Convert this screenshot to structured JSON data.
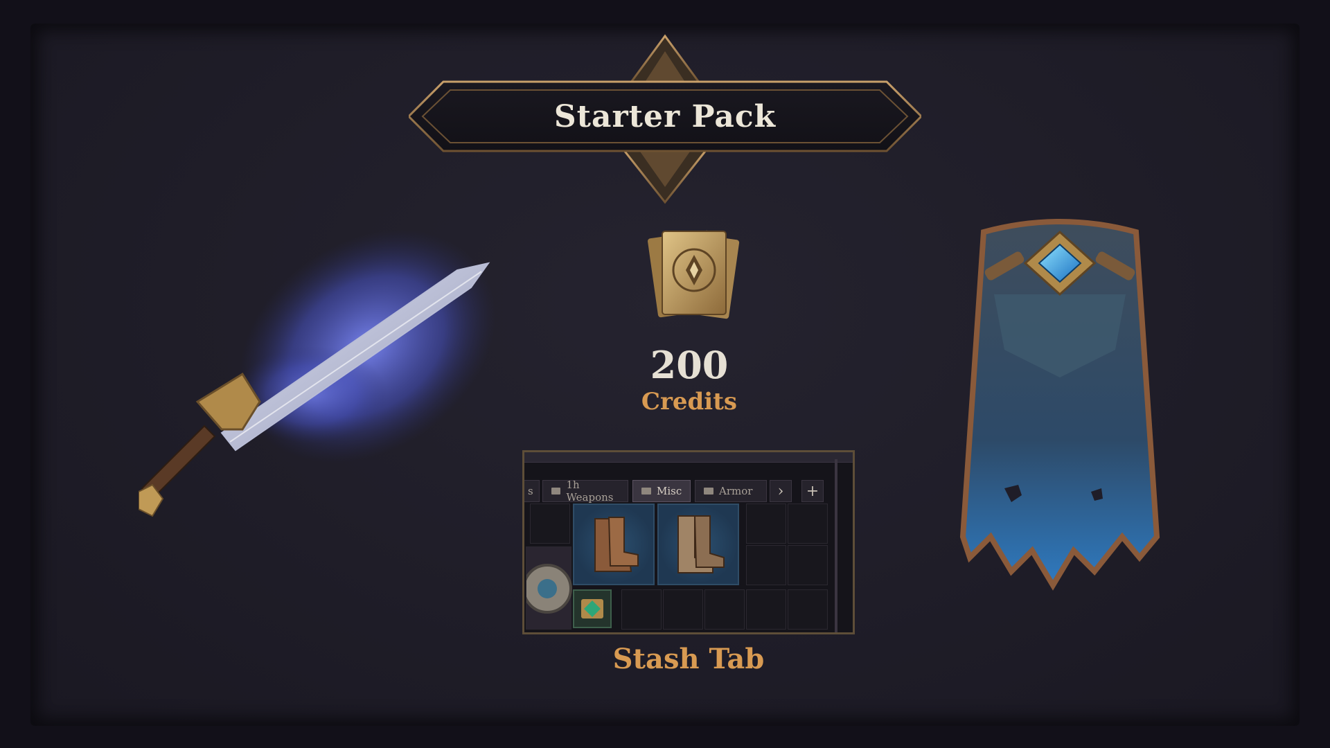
{
  "banner": {
    "title": "Starter Pack"
  },
  "credits": {
    "amount": "200",
    "label": "Credits",
    "icon": "credits-cards-icon"
  },
  "stash": {
    "label": "Stash Tab",
    "tabs": [
      {
        "label": "s",
        "icon": "folder-icon",
        "active": false
      },
      {
        "label": "1h Weapons",
        "icon": "folder-icon",
        "active": false
      },
      {
        "label": "Misc",
        "icon": "folder-icon",
        "active": true
      },
      {
        "label": "Armor",
        "icon": "folder-icon",
        "active": false
      }
    ],
    "next_symbol": "›",
    "add_symbol": "+"
  },
  "items": {
    "sword": "frost-greatsword-icon",
    "cape": "blue-cape-icon"
  },
  "colors": {
    "background": "#1f1d28",
    "accent_gold": "#d89a52",
    "text_light": "#ece6d8",
    "frame_bronze": "#8a6a45"
  }
}
